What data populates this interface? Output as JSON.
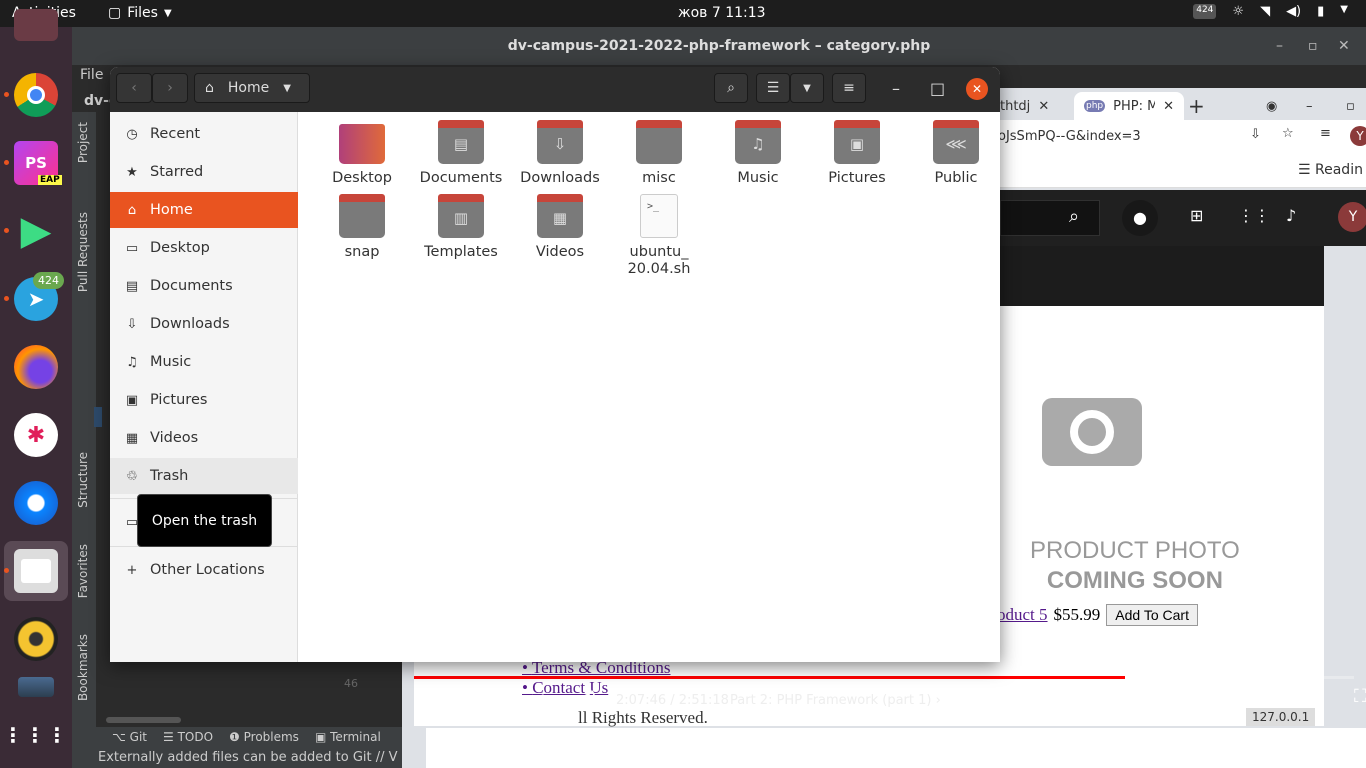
{
  "topbar": {
    "activities": "Activities",
    "app_menu": "Files",
    "clock": "жов 7  11:13",
    "tray_badge": "424"
  },
  "dock": {
    "items": [
      {
        "name": "chrome",
        "label": ""
      },
      {
        "name": "phpstorm",
        "label": "PS",
        "sub": "EAP"
      },
      {
        "name": "media-player",
        "label": ""
      },
      {
        "name": "telegram",
        "label": "",
        "badge": "424"
      },
      {
        "name": "firefox",
        "label": ""
      },
      {
        "name": "slack",
        "label": ""
      },
      {
        "name": "thunderbird",
        "label": ""
      },
      {
        "name": "files",
        "label": ""
      },
      {
        "name": "rhythmbox",
        "label": ""
      },
      {
        "name": "show-apps",
        "label": ""
      }
    ]
  },
  "ide": {
    "title": "dv-campus-2021-2022-php-framework – category.php",
    "menu_file": "File",
    "project_short": "dv-c",
    "side_tabs": [
      "Project",
      "Pull Requests",
      "Structure",
      "Favorites",
      "Bookmarks"
    ],
    "bottom_tabs": [
      "Git",
      "TODO",
      "Problems",
      "Terminal"
    ],
    "status": "Externally added files can be added to Git // V",
    "line_numbers": [
      "46"
    ]
  },
  "chrome": {
    "tabs": [
      {
        "label": "thtdj"
      },
      {
        "label": "PHP: M"
      }
    ],
    "address": "oJsSmPQ--G&index=3",
    "reading_list": "Readin",
    "avatar": "Y"
  },
  "video": {
    "photo_line1": "PRODUCT PHOTO",
    "photo_line2": "COMING SOON",
    "product_link": "oduct 5",
    "price": "$55.99",
    "add_to_cart": "Add To Cart",
    "link1": "Terms & Conditions",
    "link2": "Contact Us",
    "copyright": "ll Rights Reserved.",
    "time": "2:07:46 / 2:51:18",
    "chapter": "Part 2: PHP Framework (part 1)",
    "progress": 0.756,
    "ip": "127.0.0.1"
  },
  "nautilus": {
    "location": "Home",
    "sidebar": [
      {
        "label": "Recent",
        "icon": "clock-icon",
        "glyph": "◷"
      },
      {
        "label": "Starred",
        "icon": "star-icon",
        "glyph": "★"
      },
      {
        "label": "Home",
        "icon": "home-icon",
        "glyph": "⌂"
      },
      {
        "label": "Desktop",
        "icon": "desktop-icon",
        "glyph": "▭"
      },
      {
        "label": "Documents",
        "icon": "document-icon",
        "glyph": "▤"
      },
      {
        "label": "Downloads",
        "icon": "download-icon",
        "glyph": "⇩"
      },
      {
        "label": "Music",
        "icon": "music-icon",
        "glyph": "♫"
      },
      {
        "label": "Pictures",
        "icon": "picture-icon",
        "glyph": "▣"
      },
      {
        "label": "Videos",
        "icon": "video-icon",
        "glyph": "▦"
      },
      {
        "label": "Trash",
        "icon": "trash-icon",
        "glyph": "♲"
      }
    ],
    "other_locations": "Other Locations",
    "tooltip": "Open the trash",
    "files": [
      {
        "name": "Desktop",
        "kind": "desktop",
        "glyph": ""
      },
      {
        "name": "Documents",
        "kind": "folder",
        "glyph": "▤"
      },
      {
        "name": "Downloads",
        "kind": "folder",
        "glyph": "⇩"
      },
      {
        "name": "misc",
        "kind": "folder",
        "glyph": ""
      },
      {
        "name": "Music",
        "kind": "folder",
        "glyph": "♫"
      },
      {
        "name": "Pictures",
        "kind": "folder",
        "glyph": "▣"
      },
      {
        "name": "Public",
        "kind": "folder",
        "glyph": "⋘"
      },
      {
        "name": "snap",
        "kind": "folder",
        "glyph": ""
      },
      {
        "name": "Templates",
        "kind": "folder",
        "glyph": "▥"
      },
      {
        "name": "Videos",
        "kind": "folder",
        "glyph": "▦"
      },
      {
        "name": "ubuntu_\n20.04.sh",
        "kind": "script",
        "glyph": ">_"
      }
    ]
  }
}
